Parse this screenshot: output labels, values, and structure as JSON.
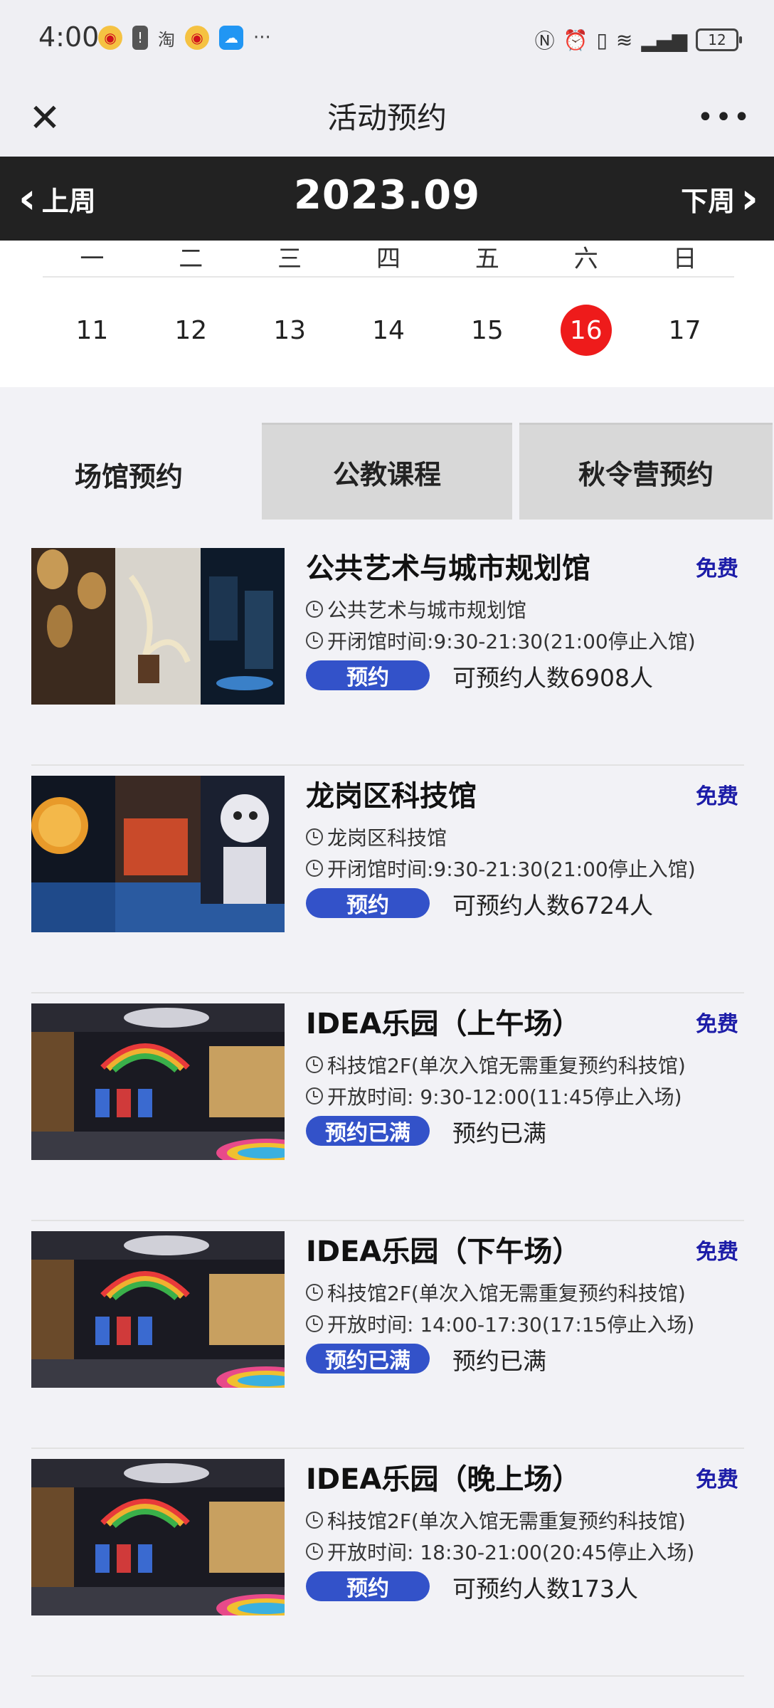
{
  "status_bar": {
    "time": "4:00",
    "battery": "12"
  },
  "header": {
    "title": "活动预约"
  },
  "week_nav": {
    "prev_label": "上周",
    "next_label": "下周",
    "month": "2023.09"
  },
  "calendar": {
    "weekdays": [
      "一",
      "二",
      "三",
      "四",
      "五",
      "六",
      "日"
    ],
    "dates": [
      "11",
      "12",
      "13",
      "14",
      "15",
      "16",
      "17"
    ],
    "selected": "16",
    "selected_color": "#ee1b1b"
  },
  "tabs": [
    {
      "label": "场馆预约",
      "active": true
    },
    {
      "label": "公教课程",
      "active": false
    },
    {
      "label": "秋令营预约",
      "active": false
    }
  ],
  "venues": [
    {
      "name": "公共艺术与城市规划馆",
      "price": "免费",
      "line1": "公共艺术与城市规划馆",
      "line2": "开闭馆时间:9:30-21:30(21:00停止入馆)",
      "button": "预约",
      "availability": "可预约人数6908人"
    },
    {
      "name": "龙岗区科技馆",
      "price": "免费",
      "line1": "龙岗区科技馆",
      "line2": "开闭馆时间:9:30-21:30(21:00停止入馆)",
      "button": "预约",
      "availability": "可预约人数6724人"
    },
    {
      "name": "IDEA乐园（上午场）",
      "price": "免费",
      "line1": "科技馆2F(单次入馆无需重复预约科技馆)",
      "line2": "开放时间:   9:30-12:00(11:45停止入场)",
      "button": "预约已满",
      "availability": "预约已满"
    },
    {
      "name": "IDEA乐园（下午场）",
      "price": "免费",
      "line1": "科技馆2F(单次入馆无需重复预约科技馆)",
      "line2": "开放时间:   14:00-17:30(17:15停止入场)",
      "button": "预约已满",
      "availability": "预约已满"
    },
    {
      "name": "IDEA乐园（晚上场）",
      "price": "免费",
      "line1": "科技馆2F(单次入馆无需重复预约科技馆)",
      "line2": "开放时间:   18:30-21:00(20:45停止入场)",
      "button": "预约",
      "availability": "可预约人数173人"
    }
  ],
  "colors": {
    "accent_button": "#3352c9",
    "price": "#1d1da8",
    "nav_bar": "#222222"
  }
}
